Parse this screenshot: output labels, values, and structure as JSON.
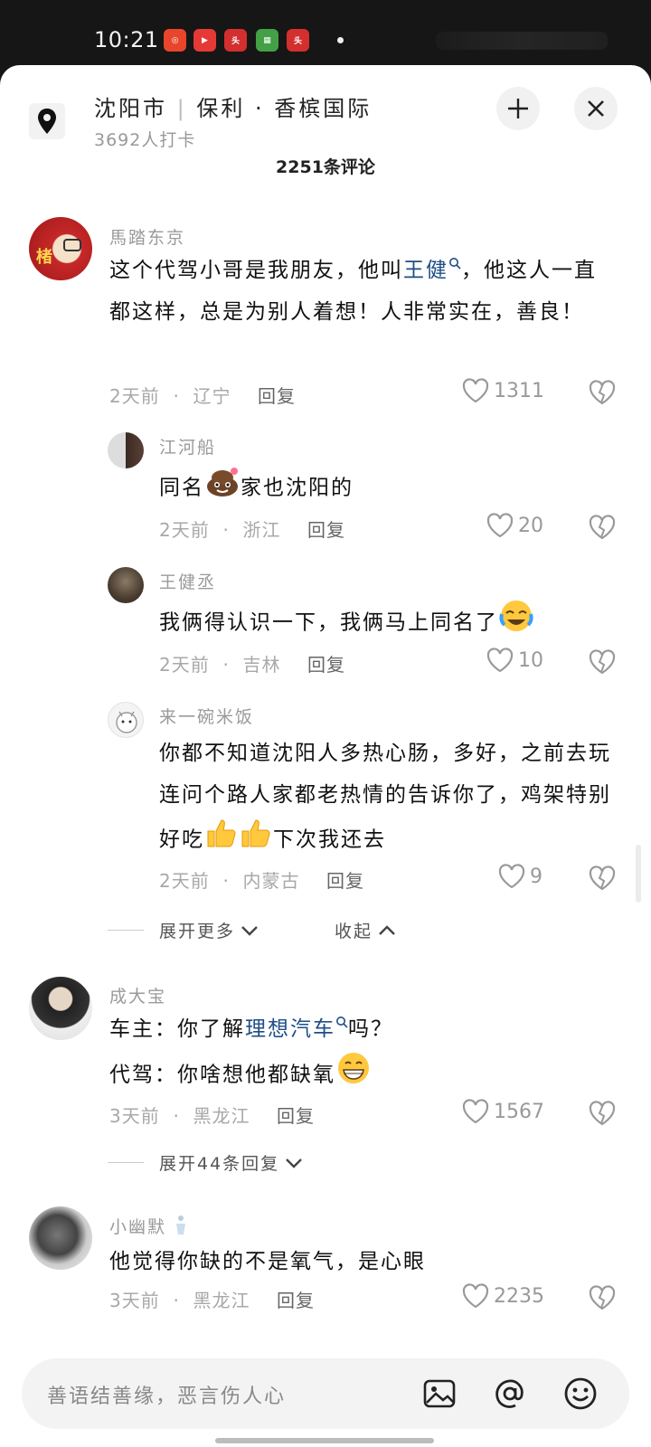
{
  "status_bar": {
    "time": "10:21"
  },
  "location": {
    "city": "沈阳市",
    "place": "保利 · 香槟国际",
    "checkins": "3692人打卡"
  },
  "comment_count": "2251条评论",
  "comments": [
    {
      "user": "馬踏东京",
      "text_pre": "这个代驾小哥是我朋友，他叫",
      "text_link": "王健",
      "text_post": "，他这人一直都这样，总是为别人着想！人非常实在，善良！",
      "time": "2天前",
      "region": "辽宁",
      "reply": "回复",
      "likes": "1311",
      "avatar_text": "楮"
    },
    {
      "user": "江河船",
      "text_pre": "同名",
      "text_post": "家也沈阳的",
      "time": "2天前",
      "region": "浙江",
      "reply": "回复",
      "likes": "20"
    },
    {
      "user": "王健丞",
      "text": "我俩得认识一下，我俩马上同名了",
      "time": "2天前",
      "region": "吉林",
      "reply": "回复",
      "likes": "10"
    },
    {
      "user": "来一碗米饭",
      "text": "你都不知道沈阳人多热心肠，多好，之前去玩连问个路人家都老热情的告诉你了，鸡架特别好吃",
      "text_post": "下次我还去",
      "time": "2天前",
      "region": "内蒙古",
      "reply": "回复",
      "likes": "9"
    },
    {
      "user": "成大宝",
      "line1_pre": "车主：你了解",
      "line1_link": "理想汽车",
      "line1_post": "吗？",
      "line2": "代驾：你啥想他都缺氧",
      "time": "3天前",
      "region": "黑龙江",
      "reply": "回复",
      "likes": "1567"
    },
    {
      "user": "小幽默",
      "text": "他觉得你缺的不是氧气，是心眼",
      "time": "3天前",
      "region": "黑龙江",
      "reply": "回复",
      "likes": "2235"
    }
  ],
  "expand_more": "展开更多",
  "collapse": "收起",
  "expand_44": "展开44条回复",
  "input_placeholder": "善语结善缘，恶言伤人心",
  "colors": {
    "link": "#1f4e86",
    "meta": "#a8a8a8",
    "background": "#ffffff"
  },
  "icons": [
    "location-pin-icon",
    "minimize-icon",
    "close-icon",
    "search-icon",
    "heart-icon",
    "broken-heart-icon",
    "chevron-down-icon",
    "chevron-up-icon",
    "image-icon",
    "at-icon",
    "emoji-icon"
  ]
}
